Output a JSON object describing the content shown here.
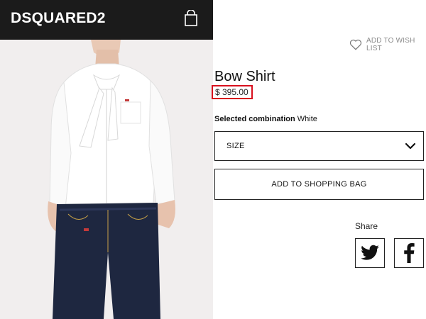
{
  "brand": {
    "logo_text": "DSQUARED2"
  },
  "header": {
    "bag_icon": "shopping-bag-icon"
  },
  "wishlist": {
    "label": "ADD TO WISH LIST",
    "icon": "heart-outline-icon"
  },
  "product": {
    "title": "Bow Shirt",
    "price": "$ 395.00",
    "price_highlight_color": "#d80f1d"
  },
  "combination": {
    "label": "Selected combination",
    "value": "White"
  },
  "size_select": {
    "label": "SIZE",
    "icon": "chevron-down-icon"
  },
  "add_to_bag": {
    "label": "ADD TO SHOPPING BAG"
  },
  "share": {
    "label": "Share",
    "buttons": [
      {
        "name": "twitter",
        "icon": "twitter-icon"
      },
      {
        "name": "facebook",
        "icon": "facebook-icon"
      }
    ]
  },
  "colors": {
    "header_bg": "#1b1b1b",
    "photo_bg": "#f1eeee",
    "text": "#111111"
  }
}
